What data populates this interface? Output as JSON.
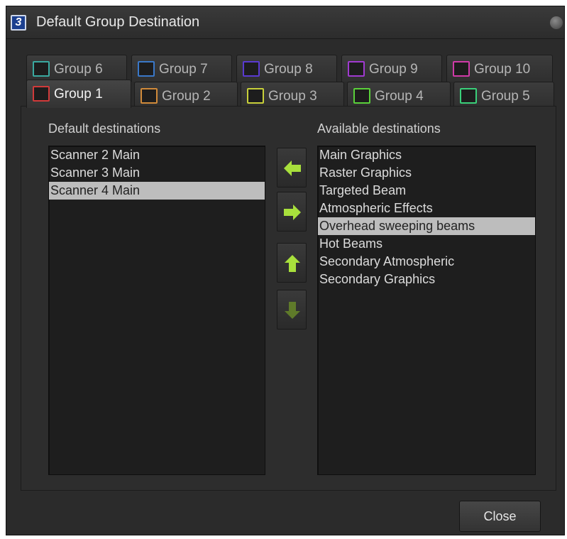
{
  "window": {
    "title": "Default Group Destination",
    "app_icon_glyph": "3"
  },
  "tabs": {
    "back_row": [
      {
        "label": "Group 6",
        "color": "#3aa9a0"
      },
      {
        "label": "Group 7",
        "color": "#3a78c8"
      },
      {
        "label": "Group 8",
        "color": "#5a3ad0"
      },
      {
        "label": "Group 9",
        "color": "#a03ad0"
      },
      {
        "label": "Group 10",
        "color": "#d03aa8"
      }
    ],
    "front_row": [
      {
        "label": "Group 1",
        "color": "#d03a3a",
        "active": true
      },
      {
        "label": "Group 2",
        "color": "#d08a3a"
      },
      {
        "label": "Group 3",
        "color": "#c8d03a"
      },
      {
        "label": "Group 4",
        "color": "#5ad03a"
      },
      {
        "label": "Group 5",
        "color": "#3ad07a"
      }
    ]
  },
  "default_destinations": {
    "label": "Default destinations",
    "items": [
      {
        "text": "Scanner 2 Main",
        "selected": false
      },
      {
        "text": "Scanner 3 Main",
        "selected": false
      },
      {
        "text": "Scanner 4 Main",
        "selected": true
      }
    ]
  },
  "available_destinations": {
    "label": "Available destinations",
    "items": [
      {
        "text": "Main Graphics",
        "selected": false
      },
      {
        "text": "Raster Graphics",
        "selected": false
      },
      {
        "text": "Targeted Beam",
        "selected": false
      },
      {
        "text": "Atmospheric Effects",
        "selected": false
      },
      {
        "text": "Overhead sweeping beams",
        "selected": true
      },
      {
        "text": "Hot Beams",
        "selected": false
      },
      {
        "text": "Secondary Atmospheric",
        "selected": false
      },
      {
        "text": "Secondary Graphics",
        "selected": false
      }
    ]
  },
  "buttons": {
    "move_left": {
      "icon": "arrow-left-icon",
      "enabled": true
    },
    "move_right": {
      "icon": "arrow-right-icon",
      "enabled": true
    },
    "move_up": {
      "icon": "arrow-up-icon",
      "enabled": true
    },
    "move_down": {
      "icon": "arrow-down-icon",
      "enabled": false
    },
    "close_label": "Close"
  },
  "colors": {
    "arrow_enabled": "#a8e03c",
    "arrow_disabled": "#5f7a2a",
    "selection": "#bdbdbd"
  }
}
